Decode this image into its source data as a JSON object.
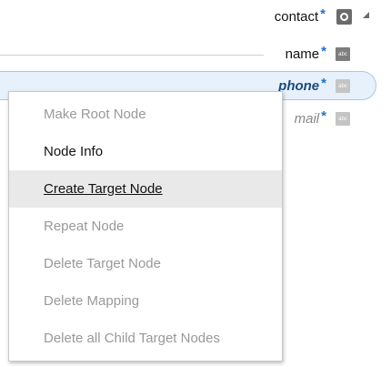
{
  "tree": {
    "root": {
      "label": "contact",
      "required_marker": "*",
      "icon": "object-icon",
      "toggle_icon": "collapse-triangle-icon"
    },
    "children": [
      {
        "label": "name",
        "required_marker": "*",
        "icon_text": "abc"
      },
      {
        "label": "phone",
        "required_marker": "*",
        "icon_text": "abc",
        "selected": true
      },
      {
        "label": "mail",
        "required_marker": "*",
        "icon_text": "abc"
      }
    ]
  },
  "context_menu": {
    "items": [
      {
        "label": "Make Root Node",
        "enabled": false
      },
      {
        "label": "Node Info",
        "enabled": true
      },
      {
        "label": "Create Target Node",
        "enabled": true,
        "highlighted": true
      },
      {
        "label": "Repeat Node",
        "enabled": false
      },
      {
        "label": "Delete Target Node",
        "enabled": false
      },
      {
        "label": "Delete Mapping",
        "enabled": false
      },
      {
        "label": "Delete all Child Target Nodes",
        "enabled": false
      }
    ]
  }
}
